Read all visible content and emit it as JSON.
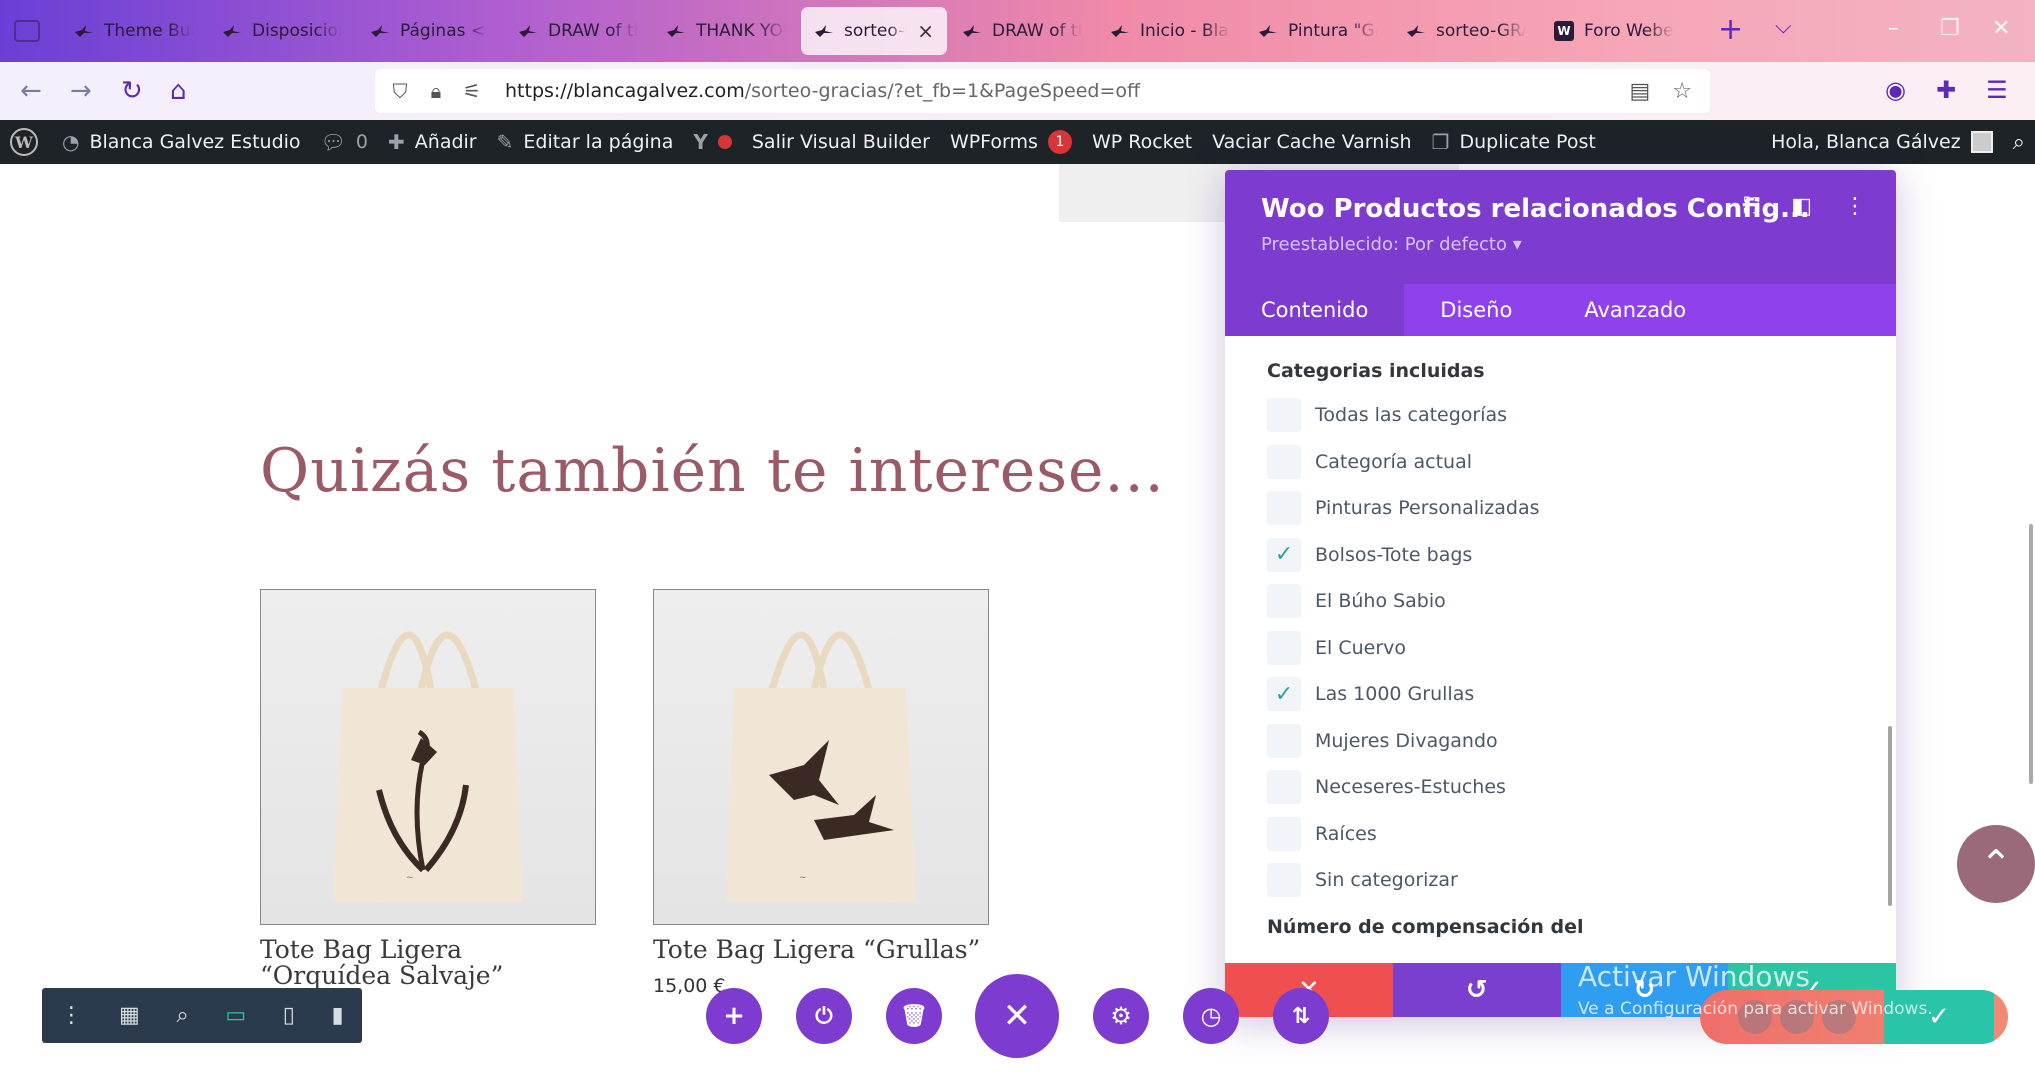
{
  "browser": {
    "tabs": [
      {
        "label": "Theme Builder",
        "active": false
      },
      {
        "label": "Disposiciones",
        "active": false
      },
      {
        "label": "Páginas < Bl",
        "active": false
      },
      {
        "label": "DRAW of the",
        "active": false
      },
      {
        "label": "THANK YOU",
        "active": false
      },
      {
        "label": "sorteo-GRA",
        "active": true
      },
      {
        "label": "DRAW of the",
        "active": false
      },
      {
        "label": "Inicio - Blan",
        "active": false
      },
      {
        "label": "Pintura \"Gru",
        "active": false
      },
      {
        "label": "sorteo-GRA",
        "active": false
      },
      {
        "label": "Foro Weber",
        "active": false
      }
    ],
    "weber_favicon": "W",
    "url_host": "https://blancagalvez.com",
    "url_path": "/sorteo-gracias/?et_fb=1&PageSpeed=off"
  },
  "adminbar": {
    "site_name": "Blanca Galvez Estudio",
    "comments_count": "0",
    "add_label": "Añadir",
    "edit_label": "Editar la página",
    "exit_builder": "Salir Visual Builder",
    "wpforms_label": "WPForms",
    "wpforms_badge": "1",
    "wp_rocket": "WP Rocket",
    "varnish": "Vaciar Cache Varnish",
    "duplicate": "Duplicate Post",
    "greeting": "Hola, Blanca Gálvez"
  },
  "page": {
    "heading": "Quizás también te interese...",
    "products": [
      {
        "title": "Tote Bag Ligera “Orquídea Salvaje”",
        "price": ""
      },
      {
        "title": "Tote Bag Ligera “Grullas”",
        "price": "15,00 €"
      }
    ]
  },
  "modal": {
    "title": "Woo Productos relacionados Config...",
    "preset": "Preestablecido: Por defecto ▾",
    "tabs": [
      "Contenido",
      "Diseño",
      "Avanzado"
    ],
    "section_title": "Categorias incluidas",
    "categories": [
      {
        "label": "Todas las categorías",
        "checked": false
      },
      {
        "label": "Categoría actual",
        "checked": false
      },
      {
        "label": "Pinturas Personalizadas",
        "checked": false
      },
      {
        "label": "Bolsos-Tote bags",
        "checked": true
      },
      {
        "label": "El Búho Sabio",
        "checked": false
      },
      {
        "label": "El Cuervo",
        "checked": false
      },
      {
        "label": "Las 1000 Grullas",
        "checked": true
      },
      {
        "label": "Mujeres Divagando",
        "checked": false
      },
      {
        "label": "Neceseres-Estuches",
        "checked": false
      },
      {
        "label": "Raíces",
        "checked": false
      },
      {
        "label": "Sin categorizar",
        "checked": false
      }
    ],
    "next_section": "Número de compensación del",
    "footer_colors": [
      "#ef4f4f",
      "#7b3fd0",
      "#2f9ef0",
      "#2cc5a3"
    ]
  },
  "windows_overlay": {
    "line1": "Activar Windows",
    "line2": "Ve a Configuración para activar Windows."
  },
  "colors": {
    "divi_purple": "#7e3bd0",
    "divi_tab": "#8f42ec",
    "check_teal": "#2ea3a0",
    "heading_rose": "#9b5a68"
  }
}
